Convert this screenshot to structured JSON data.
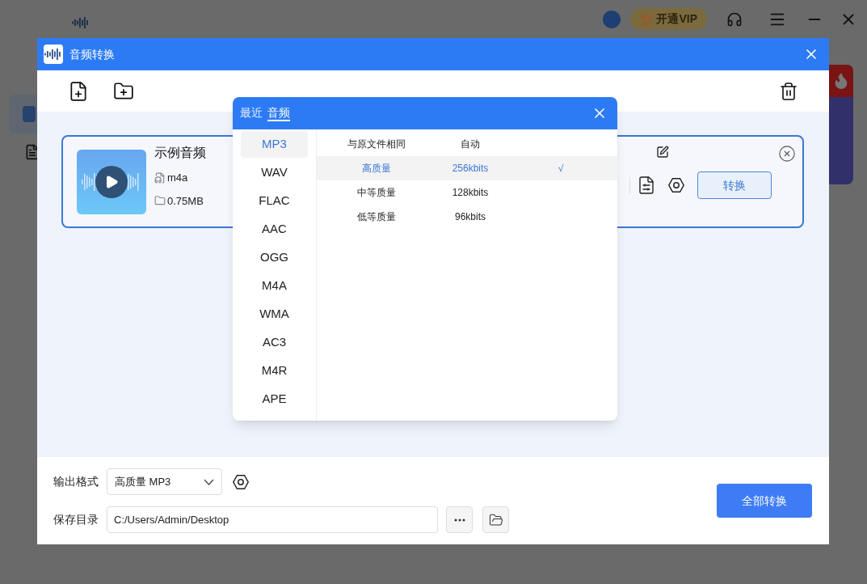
{
  "app": {
    "vip_label": "开通VIP"
  },
  "dialog": {
    "title": "音频转换"
  },
  "file": {
    "name": "示例音频",
    "format": "m4a",
    "size": "0.75MB",
    "convert_label": "转换"
  },
  "format_popup": {
    "tabs": [
      {
        "label": "最近",
        "selected": false
      },
      {
        "label": "音频",
        "selected": true
      }
    ],
    "formats": [
      {
        "label": "MP3",
        "selected": true
      },
      {
        "label": "WAV",
        "selected": false
      },
      {
        "label": "FLAC",
        "selected": false
      },
      {
        "label": "AAC",
        "selected": false
      },
      {
        "label": "OGG",
        "selected": false
      },
      {
        "label": "M4A",
        "selected": false
      },
      {
        "label": "WMA",
        "selected": false
      },
      {
        "label": "AC3",
        "selected": false
      },
      {
        "label": "M4R",
        "selected": false
      },
      {
        "label": "APE",
        "selected": false
      }
    ],
    "check": "√",
    "presets": [
      {
        "quality": "与原文件相同",
        "bitrate": "自动",
        "selected": false
      },
      {
        "quality": "高质量",
        "bitrate": "256kbits",
        "selected": true
      },
      {
        "quality": "中等质量",
        "bitrate": "128kbits",
        "selected": false
      },
      {
        "quality": "低等质量",
        "bitrate": "96kbits",
        "selected": false
      }
    ]
  },
  "output": {
    "format_label": "输出格式",
    "format_value": "高质量 MP3",
    "dir_label": "保存目录",
    "dir_value": "C:/Users/Admin/Desktop",
    "convert_all_label": "全部转换"
  }
}
